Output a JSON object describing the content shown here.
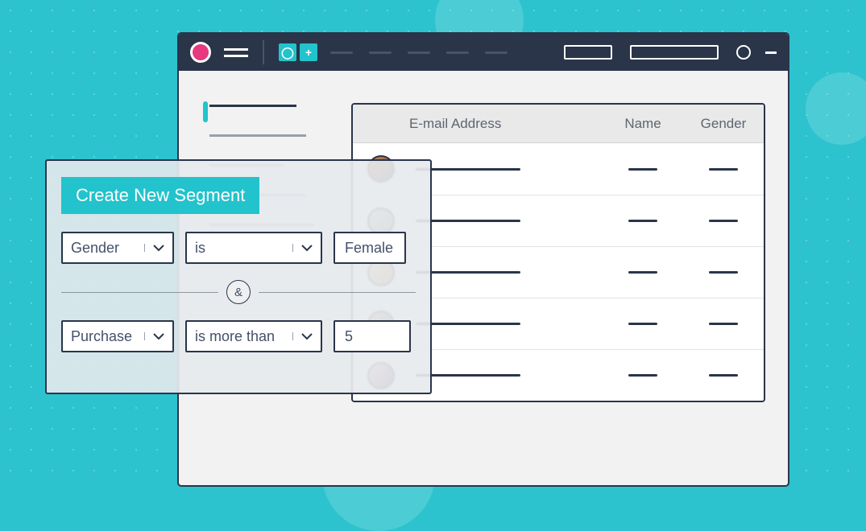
{
  "colors": {
    "accent": "#22c3cc",
    "brand_pink": "#e6397f",
    "chrome": "#2a354a",
    "background": "#2dc3ce"
  },
  "toolbar": {
    "logo_icon": "brand-dot",
    "menu_icon": "hamburger-icon",
    "quick_buttons": [
      "circle",
      "plus"
    ]
  },
  "table": {
    "headers": {
      "email": "E-mail Address",
      "name": "Name",
      "gender": "Gender"
    },
    "rows": [
      {
        "avatar_bg": "linear-gradient(135deg,#c98a5a,#6b4a34)"
      },
      {
        "avatar_bg": "linear-gradient(135deg,#d8d4cc,#8a837a)"
      },
      {
        "avatar_bg": "linear-gradient(135deg,#e8d9a8,#a8915a)"
      },
      {
        "avatar_bg": "linear-gradient(135deg,#d6b99a,#7a5a44)"
      },
      {
        "avatar_bg": "linear-gradient(135deg,#e8c9d4,#6b4a54)"
      }
    ]
  },
  "segment": {
    "title": "Create New Segment",
    "and_symbol": "&",
    "conditions": [
      {
        "field": "Gender",
        "operator": "is",
        "value": "Female"
      },
      {
        "field": "Purchase",
        "operator": "is more than",
        "value": "5"
      }
    ]
  }
}
